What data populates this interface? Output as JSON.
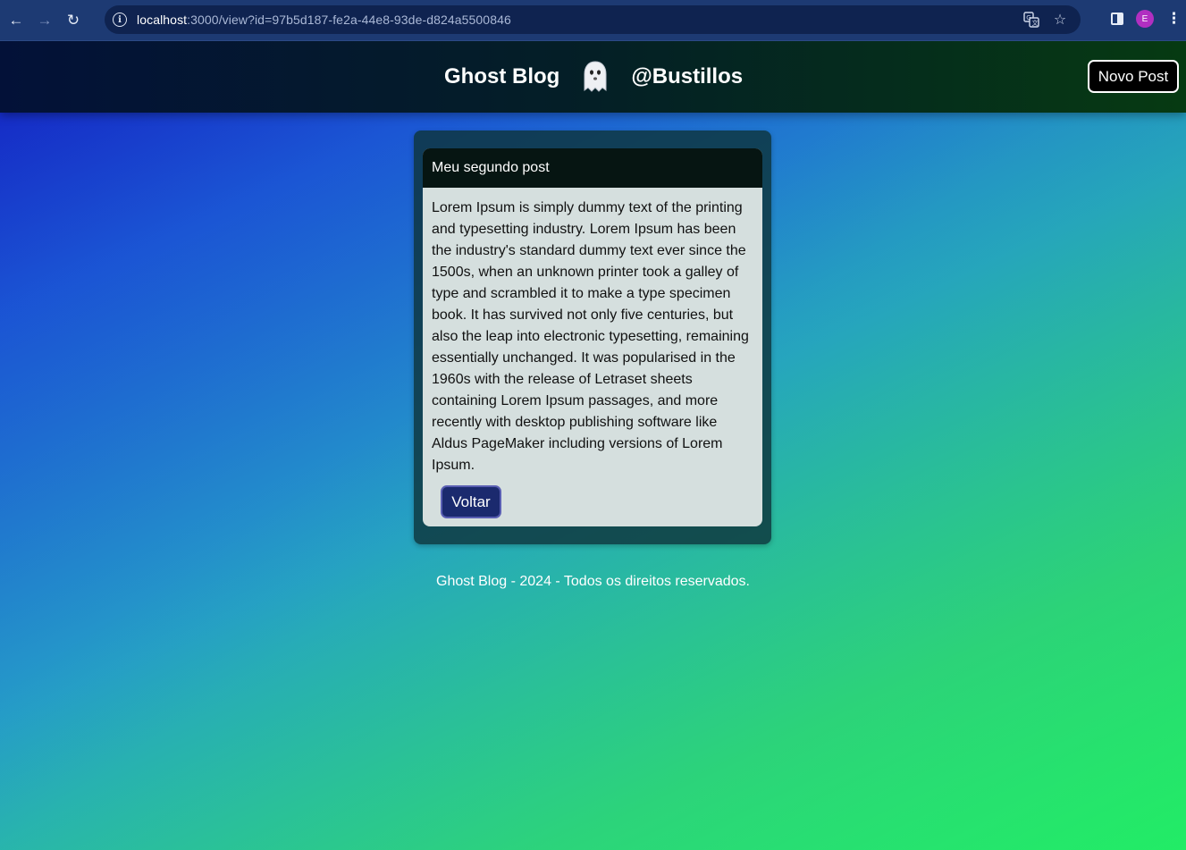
{
  "browser": {
    "url_host": "localhost",
    "url_rest": ":3000/view?id=97b5d187-fe2a-44e8-93de-d824a5500846",
    "profile_initial": "E",
    "icons": {
      "back": "back-arrow-icon",
      "forward": "forward-arrow-icon",
      "reload": "reload-icon",
      "info": "site-info-icon",
      "translate": "translate-icon",
      "bookmark": "star-icon",
      "side_panel": "side-panel-icon",
      "menu": "kebab-menu-icon"
    }
  },
  "header": {
    "title": "Ghost Blog",
    "handle": "@Bustillos",
    "new_post_label": "Novo Post"
  },
  "post": {
    "title": "Meu segundo post",
    "body": "Lorem Ipsum is simply dummy text of the printing and typesetting industry. Lorem Ipsum has been the industry's standard dummy text ever since the 1500s, when an unknown printer took a galley of type and scrambled it to make a type specimen book. It has survived not only five centuries, but also the leap into electronic typesetting, remaining essentially unchanged. It was popularised in the 1960s with the release of Letraset sheets containing Lorem Ipsum passages, and more recently with desktop publishing software like Aldus PageMaker including versions of Lorem Ipsum.",
    "back_label": "Voltar"
  },
  "footer": {
    "text": "Ghost Blog - 2024 - Todos os direitos reservados."
  },
  "colors": {
    "header_bg": "#041f26",
    "card_header_bg": "#061512",
    "card_body_bg": "#d5dfde",
    "back_button_bg": "#1b2a6e"
  }
}
